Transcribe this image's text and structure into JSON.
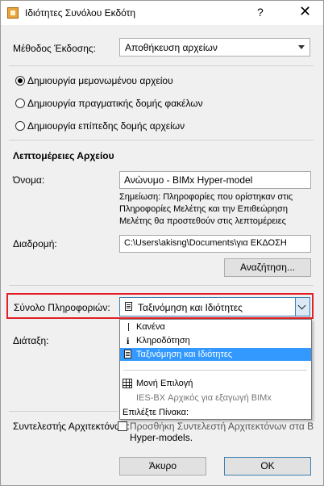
{
  "window": {
    "title": "Ιδιότητες Συνόλου Εκδότη",
    "help_glyph": "?",
    "close_glyph": "✕"
  },
  "method": {
    "label": "Μέθοδος Έκδοσης:",
    "value": "Αποθήκευση αρχείων"
  },
  "radios": [
    {
      "label": "Δημιουργία μεμονωμένου αρχείου",
      "checked": true
    },
    {
      "label": "Δημιουργία πραγματικής δομής φακέλων",
      "checked": false
    },
    {
      "label": "Δημιουργία επίπεδης δομής αρχείων",
      "checked": false
    }
  ],
  "details": {
    "heading": "Λεπτομέρειες Αρχείου",
    "name_label": "Όνομα:",
    "name_value": "Ανώνυμο - BIMx Hyper-model",
    "note": "Σημείωση: Πληροφορίες που ορίστηκαν στις Πληροφορίες Μελέτης και την Επιθεώρηση Μελέτης θα προστεθούν στις λεπτομέρειες",
    "path_label": "Διαδρομή:",
    "path_value": "C:\\Users\\akisng\\Documents\\για ΕΚΔΟΣΗ",
    "browse_label": "Αναζήτηση..."
  },
  "info_set": {
    "label": "Σύνολο Πληροφοριών:",
    "value": "Ταξινόμηση και Ιδιότητες"
  },
  "layout": {
    "label": "Διάταξη:"
  },
  "dropdown": {
    "items": [
      {
        "label": "Κανένα",
        "icon": "pipe-icon"
      },
      {
        "label": "Κληροδότηση",
        "icon": "info-icon"
      },
      {
        "label": "Ταξινόμηση και Ιδιότητες",
        "icon": "list-icon",
        "selected": true
      }
    ],
    "single_choice": "Μονή Επιλογή",
    "ies_item": "IES-BX Αρχικός για εξαγωγή BIMx",
    "choose_tables": "Επιλέξτε Πίνακα:"
  },
  "architect": {
    "label": "Συντελεστής Αρχιτεκτόνων:",
    "partial_line1": "Προσθήκη Συντελεστή Αρχιτεκτόνων στα BIMx",
    "line2": "Hyper-models."
  },
  "buttons": {
    "cancel": "Άκυρο",
    "ok": "OK"
  },
  "colors": {
    "highlight": "#e21f26",
    "selection": "#3399ff",
    "accent": "#3c7fb1"
  }
}
